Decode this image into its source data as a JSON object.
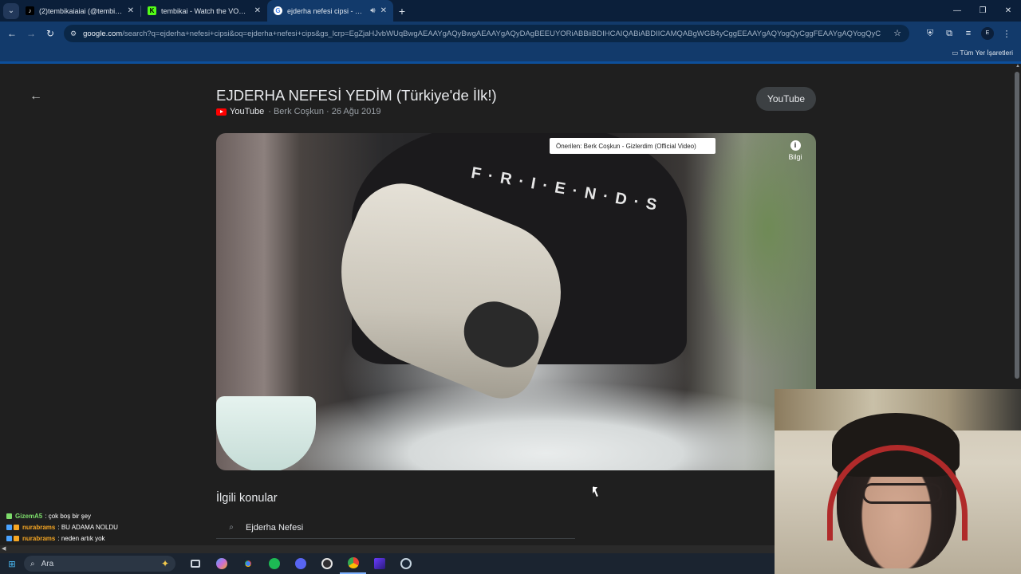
{
  "browser": {
    "tabs": [
      {
        "title": "(2)tembikaiaiai (@tembikaiaia",
        "favicon": "tiktok-icon",
        "active": false
      },
      {
        "title": "tembikai - Watch the VOD on K",
        "favicon": "kick-icon",
        "active": false
      },
      {
        "title": "ejderha nefesi cipsi - Google",
        "favicon": "google-icon",
        "active": true
      }
    ],
    "url_host": "google.com",
    "url_rest": "/search?q=ejderha+nefesi+cipsi&oq=ejderha+nefesi+cips&gs_lcrp=EgZjaHJvbWUqBwgAEAAYgAQyBwgAEAAYgAQyDAgBEEUYORiABBiiBDIHCAIQABiABDIICAMQABgWGB4yCggEEAAYgAQYogQyCggFEAAYgAQYogQyCggGEAAYgAQ...",
    "avatar_letter": "E",
    "bookmarks_all": "Tüm Yer İşaretleri"
  },
  "page": {
    "video_title": "EJDERHA NEFESİ YEDİM (Türkiye'de İlk!)",
    "source": "YouTube",
    "channel": "Berk Coşkun",
    "date": "26 Ağu 2019",
    "youtube_button": "YouTube",
    "suggestion": "Önerilen: Berk Coşkun - Gizlerdim (Official Video)",
    "info_label": "Bilgi",
    "friends_text": "F·R·I·E·N·D·S",
    "related_heading": "İlgili konular",
    "related_items": [
      "Ejderha Nefesi"
    ]
  },
  "chat": [
    {
      "user": "GizemA5",
      "message": "çok boş bir şey",
      "color": "#7ddc6b"
    },
    {
      "user": "nurabrams",
      "message": "BU ADAMA NOLDU",
      "color": "#f5a623"
    },
    {
      "user": "nurabrams",
      "message": "neden artık yok",
      "color": "#f5a623"
    }
  ],
  "taskbar": {
    "search_placeholder": "Ara"
  },
  "colors": {
    "tabbar": "#0b1f3a",
    "toolbar": "#123a6b",
    "page_bg": "#1f1f1f",
    "youtube_red": "#ff0000"
  }
}
